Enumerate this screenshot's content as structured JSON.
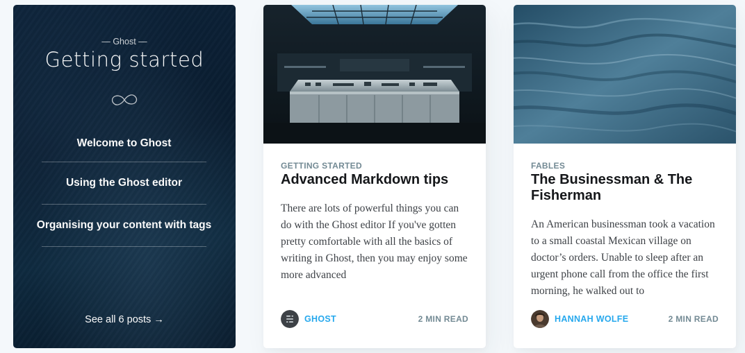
{
  "series": {
    "kicker": "— Ghost —",
    "title": "Getting started",
    "icon": "infinity-icon",
    "items": [
      {
        "label": "Welcome to Ghost"
      },
      {
        "label": "Using the Ghost editor"
      },
      {
        "label": "Organising your content with tags"
      }
    ],
    "see_all": "See all 6 posts →"
  },
  "posts": [
    {
      "tag": "Getting Started",
      "title": "Advanced Markdown tips",
      "excerpt": "There are lots of powerful things you can do with the Ghost editor If you've gotten pretty comfortable with all the basics of writing in Ghost, then you may enjoy some more advanced",
      "author": "Ghost",
      "author_icon": "ghost-logo-icon",
      "reading_time": "2 min read"
    },
    {
      "tag": "Fables",
      "title": "The Businessman & The Fisherman",
      "excerpt": "An American businessman took a vacation to a small coastal Mexican village on doctor’s orders. Unable to sleep after an urgent phone call from the office the first morning, he walked out to",
      "author": "Hannah Wolfe",
      "author_icon": "avatar-icon",
      "reading_time": "2 min read"
    }
  ],
  "colors": {
    "accent": "#26a8ed",
    "meta": "#738a94",
    "heading": "#15171a",
    "series_bg": "#0c2238"
  }
}
